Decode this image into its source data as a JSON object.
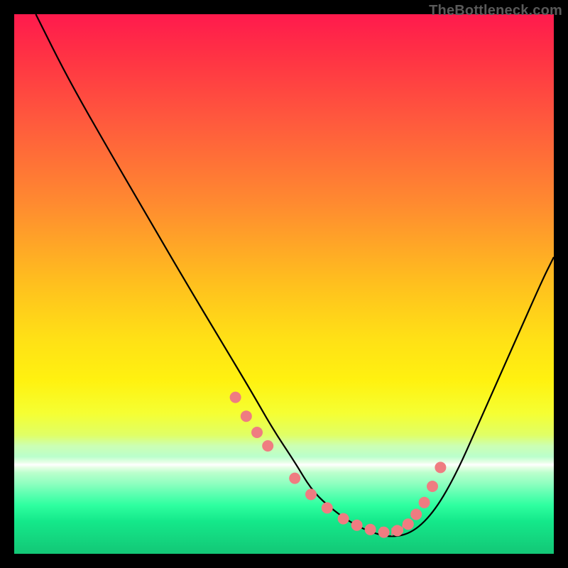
{
  "attribution": "TheBottleneck.com",
  "chart_data": {
    "type": "line",
    "title": "",
    "xlabel": "",
    "ylabel": "",
    "xlim": [
      0,
      100
    ],
    "ylim": [
      0,
      100
    ],
    "series": [
      {
        "name": "bottleneck-curve",
        "x": [
          4,
          10,
          18,
          25,
          32,
          38,
          44,
          48,
          52,
          55,
          58,
          62,
          66,
          70,
          74,
          78,
          82,
          86,
          90,
          94,
          98,
          100
        ],
        "y": [
          100,
          88,
          74,
          62,
          50,
          40,
          30,
          23,
          17,
          12,
          9,
          6,
          4,
          3,
          4,
          8,
          15,
          24,
          33,
          42,
          51,
          55
        ]
      }
    ],
    "markers": {
      "name": "highlight-points",
      "x": [
        41,
        43,
        45,
        47,
        52,
        55,
        58,
        61,
        63.5,
        66,
        68.5,
        71,
        73,
        74.5,
        76,
        77.5,
        79
      ],
      "y": [
        29,
        25.5,
        22.5,
        20,
        14,
        11,
        8.5,
        6.5,
        5.3,
        4.5,
        4.0,
        4.3,
        5.5,
        7.3,
        9.5,
        12.5,
        16
      ]
    },
    "tick_markers": {
      "x": [
        66,
        68,
        70,
        72,
        73.5
      ],
      "y": [
        4.0,
        3.8,
        3.6,
        4.2,
        5.0
      ]
    }
  }
}
